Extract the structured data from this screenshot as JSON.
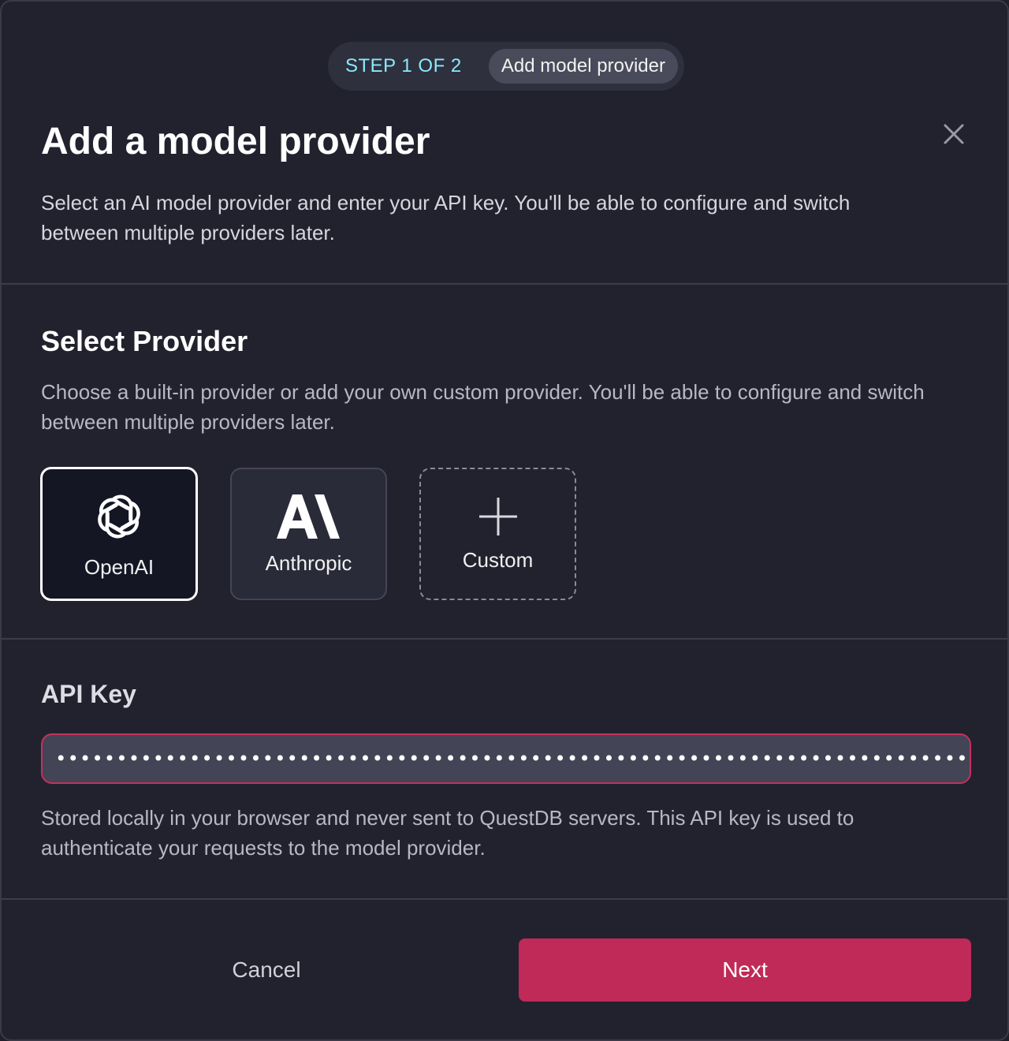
{
  "stepper": {
    "step_count": "STEP 1 OF 2",
    "step_name": "Add model provider"
  },
  "header": {
    "title": "Add a model provider",
    "subtitle": "Select an AI model provider and enter your API key. You'll be able to configure and switch between multiple providers later.",
    "close_icon": "close-icon"
  },
  "provider_section": {
    "title": "Select Provider",
    "description": "Choose a built-in provider or add your own custom provider. You'll be able to configure and switch between multiple providers later.",
    "providers": [
      {
        "label": "OpenAI",
        "icon": "openai-logo-icon",
        "selected": true
      },
      {
        "label": "Anthropic",
        "icon": "anthropic-logo-icon",
        "selected": false
      },
      {
        "label": "Custom",
        "icon": "plus-icon",
        "selected": false
      }
    ]
  },
  "api_key": {
    "label": "API Key",
    "value": "•••••••••••••••••••••••••••••••••••••••••••••••••••••••••••••••••••••••••••••••••••••••••••••••••••••••••••••••••••••••",
    "help": "Stored locally in your browser and never sent to QuestDB servers. This API key is used to authenticate your requests to the model provider."
  },
  "footer": {
    "cancel_label": "Cancel",
    "next_label": "Next"
  },
  "colors": {
    "accent": "#c02a58",
    "step_text": "#8be9fd",
    "background": "#22222e"
  }
}
